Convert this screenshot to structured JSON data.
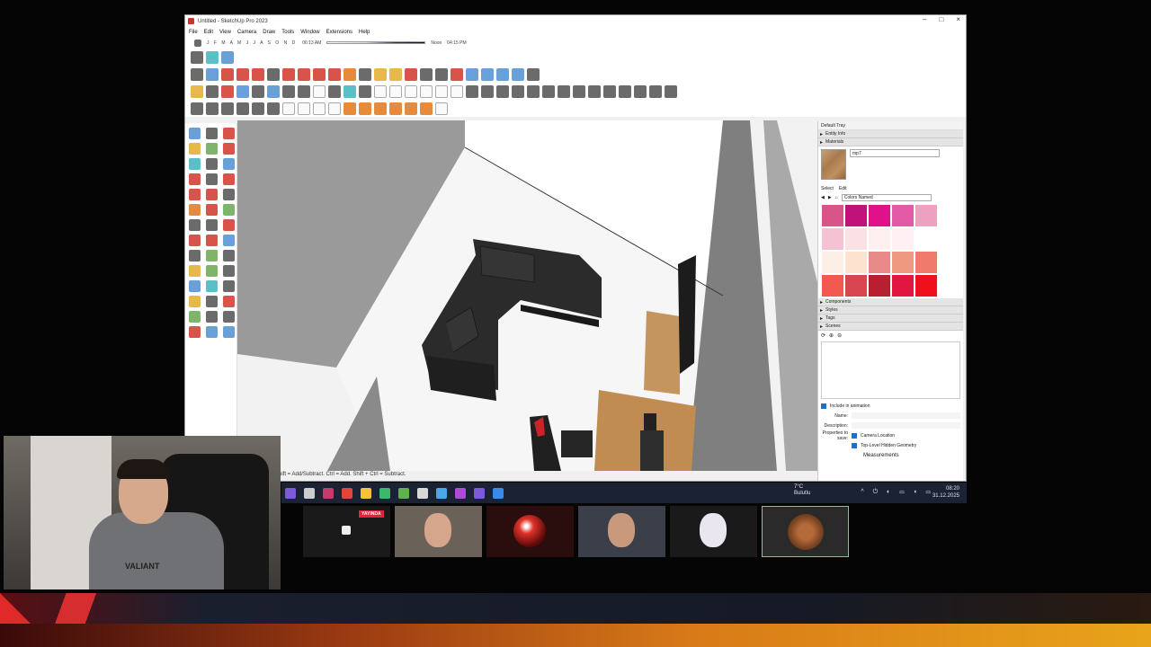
{
  "window": {
    "title": "Untitled - SketchUp Pro 2023",
    "controls": [
      "–",
      "□",
      "×"
    ]
  },
  "menu": [
    "File",
    "Edit",
    "View",
    "Camera",
    "Draw",
    "Tools",
    "Window",
    "Extensions",
    "Help"
  ],
  "shadow": {
    "months": "J F M A M J J A S O N D",
    "sunrise": "06:13 AM",
    "noon": "Noon",
    "sunset": "04:15 PM"
  },
  "status_bar": "Shift = Add/Subtract. Ctrl = Add. Shift + Ctrl = Subtract.",
  "tray": {
    "title": "Default Tray",
    "entity_info": "Entity Info",
    "materials": "Materials",
    "material_name": "mp7",
    "select_tab": "Select",
    "edit_tab": "Edit",
    "library": "Colors Named",
    "swatches": [
      "#d8558a",
      "#c0137a",
      "#e0128a",
      "#e35aa6",
      "#eea0c0",
      "#f4c2d3",
      "#fbe0e4",
      "#fff0f0",
      "#fff0f4",
      "#ffffff",
      "#fbefe6",
      "#fde3cf",
      "#e88a8a",
      "#ef9a80",
      "#f07a6c",
      "#f25a4e",
      "#d64550",
      "#b82032",
      "#e01540",
      "#f0101a"
    ],
    "components": "Components",
    "styles": "Styles",
    "tags": "Tags",
    "scenes": "Scenes",
    "include_animation": "Include in animation",
    "name_label": "Name:",
    "description_label": "Description:",
    "properties_label": "Properties to save:",
    "camera_location": "Camera Location",
    "hidden_geometry": "Top-Level Hidden Geometry",
    "measurements": "Measurements"
  },
  "taskbar": {
    "weather_temp": "7°C",
    "weather_desc": "Bulutlu",
    "time": "08:20",
    "date": "31.12.2025",
    "sys_icons": "^ ⏻ ◐ ▭ ◖ ▭",
    "app_colors": [
      "#7b5ad8",
      "#cccccc",
      "#c23b6a",
      "#e0443a",
      "#f3c33a",
      "#3bb86a",
      "#5fb24a",
      "#d8d8d8",
      "#4aa8e8",
      "#b04ad8",
      "#7b5ad8",
      "#3a8ae8"
    ]
  },
  "stream": {
    "live_badge": "YAYINDA",
    "shirt_text": "VALIANT"
  }
}
